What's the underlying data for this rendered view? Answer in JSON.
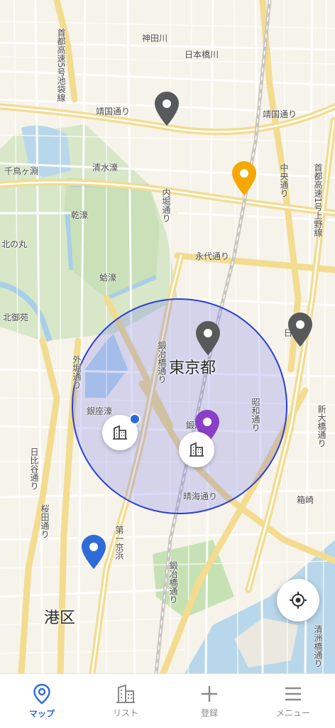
{
  "map": {
    "road_labels": [
      "靖国通り",
      "靖国通り",
      "内堀通り",
      "永代通り",
      "中央通り",
      "昭和通り",
      "晴海通り",
      "鍛冶橋通り",
      "日比谷通り",
      "桜田通り",
      "外堀通り",
      "清洲橋通り",
      "新大橋通り",
      "首都高速1号上野線",
      "首都高速5号池袋線",
      "第一京浜",
      "鍛冶橋通り"
    ],
    "place_labels": [
      "千鳥ヶ淵",
      "清水濠",
      "乾濠",
      "蛤濠",
      "北の丸",
      "北御苑",
      "鍛冶橋",
      "日比谷",
      "銀座濠",
      "箱崎",
      "神田川",
      "日本橋川"
    ],
    "districts": [
      "東京都",
      "港区"
    ],
    "search_radius_color": "#2b3fd6",
    "pins": [
      {
        "name": "map-pin-gray",
        "color": "#58595b"
      },
      {
        "name": "map-pin-orange",
        "color": "#f5a800"
      },
      {
        "name": "map-pin-gray",
        "color": "#58595b"
      },
      {
        "name": "map-pin-gray",
        "color": "#58595b"
      },
      {
        "name": "map-pin-purple",
        "color": "#8a3fc7"
      },
      {
        "name": "map-pin-blue",
        "color": "#2f6bd8"
      }
    ]
  },
  "nav": {
    "tabs": [
      {
        "label": "マップ",
        "icon": "map-pin-icon",
        "active": true
      },
      {
        "label": "リスト",
        "icon": "building-icon",
        "active": false
      },
      {
        "label": "登録",
        "icon": "plus-icon",
        "active": false
      },
      {
        "label": "メニュー",
        "icon": "hamburger-menu-icon",
        "active": false
      }
    ],
    "active_color": "#2f6bd8",
    "inactive_color": "#8a8a8a"
  }
}
